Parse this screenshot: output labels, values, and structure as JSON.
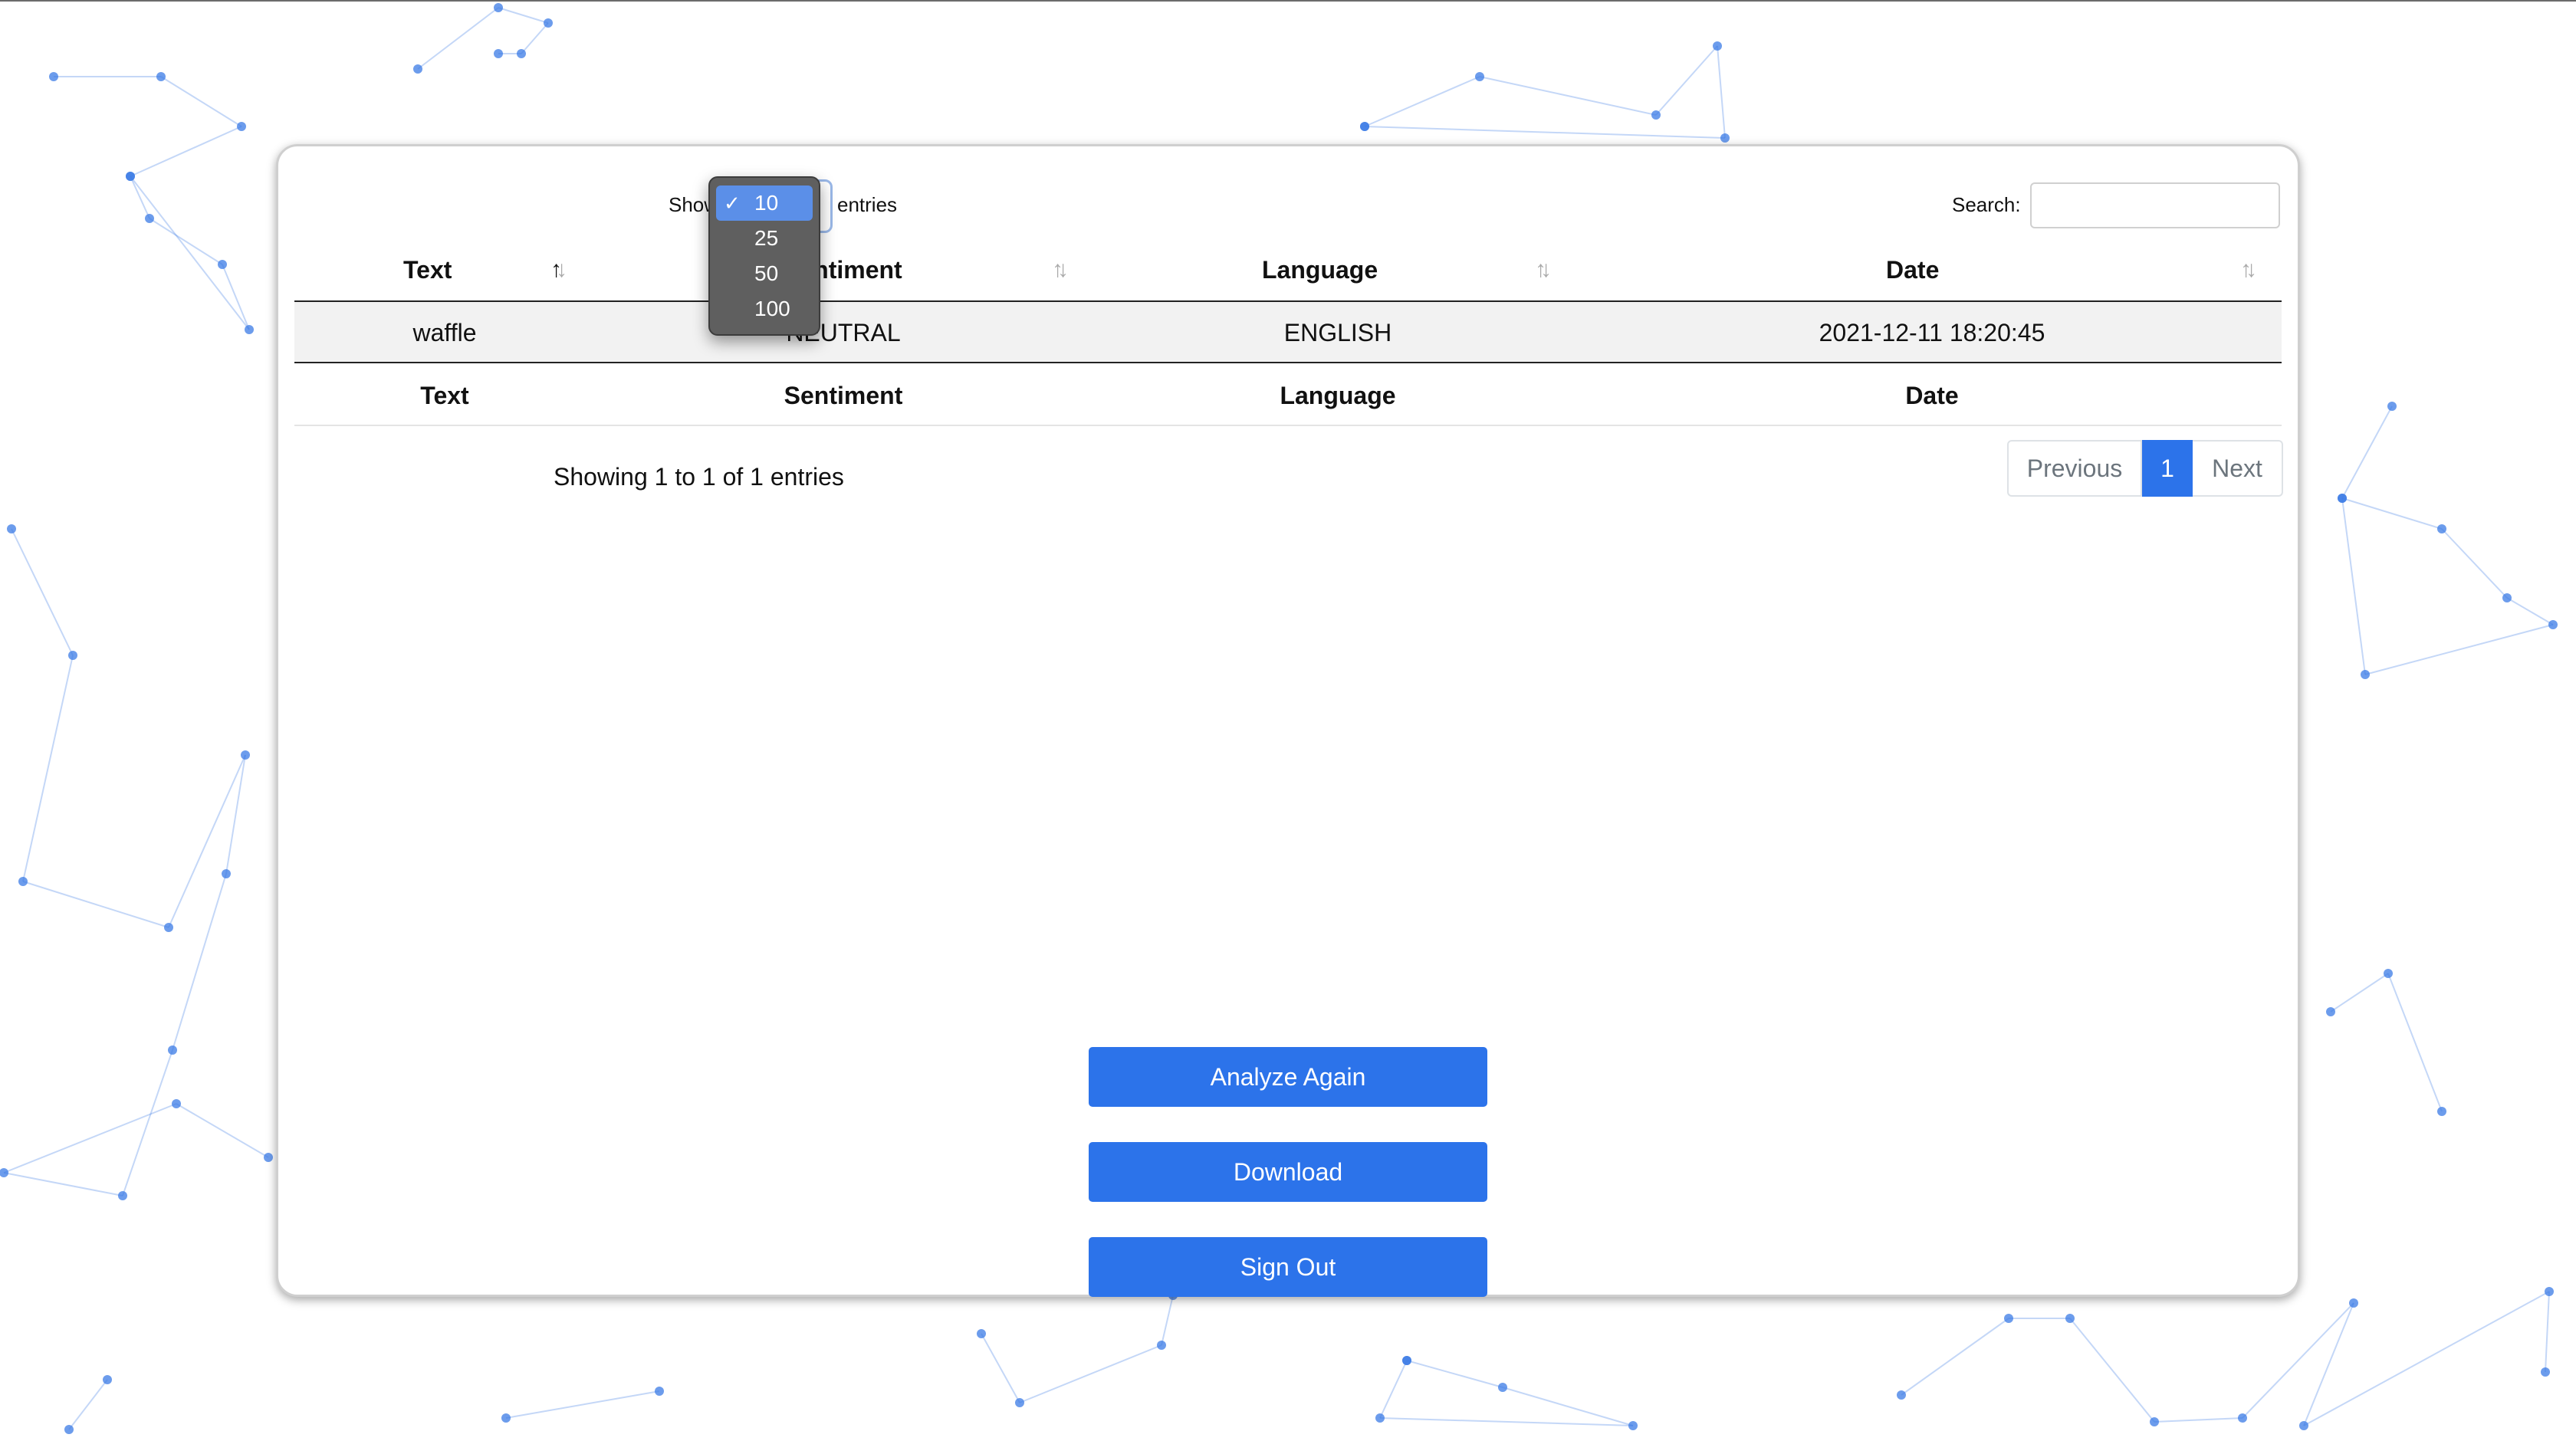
{
  "length_control": {
    "prefix": "Show",
    "suffix": "entries",
    "options": [
      {
        "label": "10",
        "selected": true
      },
      {
        "label": "25",
        "selected": false
      },
      {
        "label": "50",
        "selected": false
      },
      {
        "label": "100",
        "selected": false
      }
    ],
    "check_glyph": "✓"
  },
  "search": {
    "label": "Search:",
    "value": ""
  },
  "table": {
    "columns": [
      "Text",
      "Sentiment",
      "Language",
      "Date"
    ],
    "rows": [
      {
        "text": "waffle",
        "sentiment": "NEUTRAL",
        "language": "ENGLISH",
        "date": "2021-12-11 18:20:45"
      }
    ],
    "footer": [
      "Text",
      "Sentiment",
      "Language",
      "Date"
    ],
    "sort": {
      "column": "Text",
      "direction": "ascending"
    }
  },
  "info": "Showing 1 to 1 of 1 entries",
  "pagination": {
    "previous": "Previous",
    "current": "1",
    "next": "Next"
  },
  "actions": {
    "analyze": "Analyze Again",
    "download": "Download",
    "signout": "Sign Out"
  },
  "colors": {
    "accent": "#2c73ea",
    "network": "#3b7be6",
    "row_stripe": "#f2f2f2"
  },
  "icons": {
    "sort": "sort-arrows-icon",
    "check": "checkmark-icon"
  }
}
